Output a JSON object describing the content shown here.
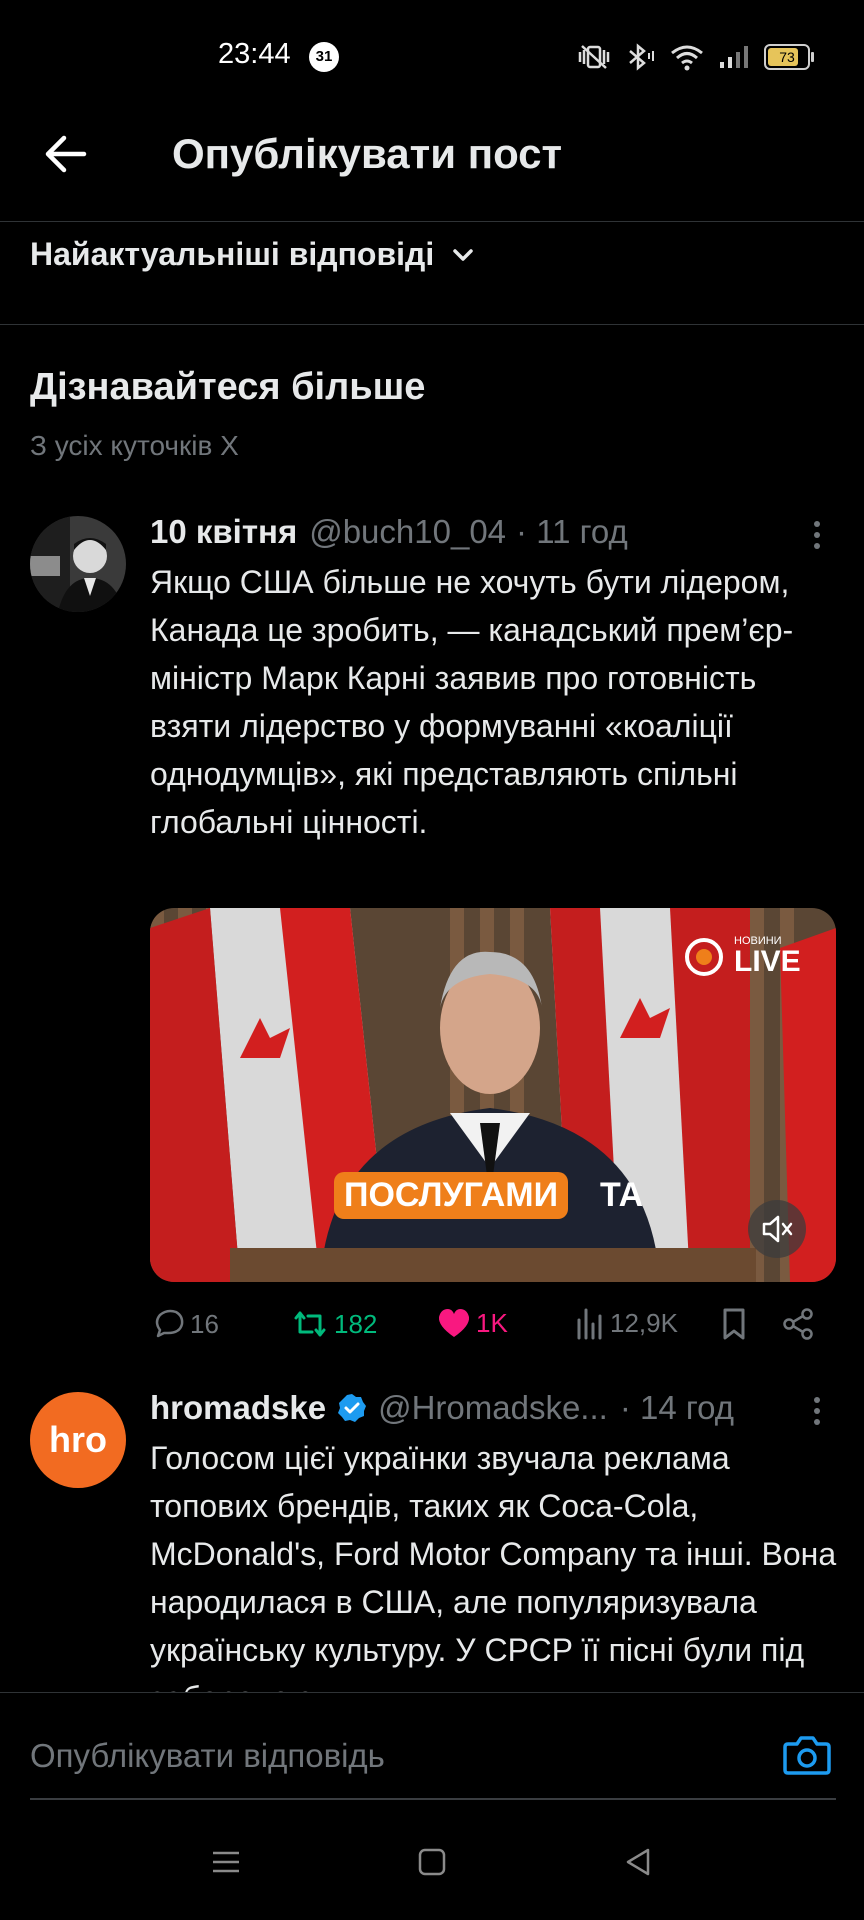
{
  "status_bar": {
    "time": "23:44",
    "calendar_badge": "31",
    "battery": "73"
  },
  "header": {
    "title": "Опублікувати пост"
  },
  "sort": {
    "label": "Найактуальніші відповіді"
  },
  "discover": {
    "title": "Дізнавайтеся більше",
    "subtitle": "З усіх куточків X"
  },
  "tweets": [
    {
      "name": "10 квітня",
      "handle": "@buch10_04",
      "time": "· 11 год",
      "text": "Якщо США більше не хочуть бути лідером, Канада це зробить, — канадський прем’єр-міністр Марк Карні заявив про готовність взяти лідерство у формуванні «коаліції однодумців», які представляють спільні глобальні цінності.",
      "media": {
        "caption": "ПОСЛУГАМИ",
        "caption_tail": "ТА",
        "channel_small": "НОВИНИ",
        "channel": "LIVE"
      },
      "stats": {
        "replies": "16",
        "reposts": "182",
        "likes": "1K",
        "views": "12,9K"
      }
    },
    {
      "avatar_text": "hro",
      "name": "hromadske",
      "handle": "@Hromadske...",
      "time": "· 14 год",
      "text": "Голосом цієї українки звучала реклама топових брендів, таких як Coca-Cola, McDonald's, Ford Motor Company та інші. Вона народилася в США, але популяризувала українську культуру. У СРСР її пісні були під забороною"
    }
  ],
  "composer": {
    "placeholder": "Опублікувати відповідь"
  },
  "colors": {
    "background": "#000000",
    "text": "#e7e9ea",
    "muted": "#71767b",
    "repost": "#00ba7c",
    "like": "#f91880",
    "accent": "#1d9bf0",
    "hromadske": "#f26b21"
  },
  "icons": [
    "back-arrow-icon",
    "chevron-down-icon",
    "more-icon",
    "reply-icon",
    "repost-icon",
    "heart-icon",
    "views-icon",
    "bookmark-icon",
    "share-icon",
    "camera-icon",
    "verified-icon",
    "mute-icon"
  ]
}
